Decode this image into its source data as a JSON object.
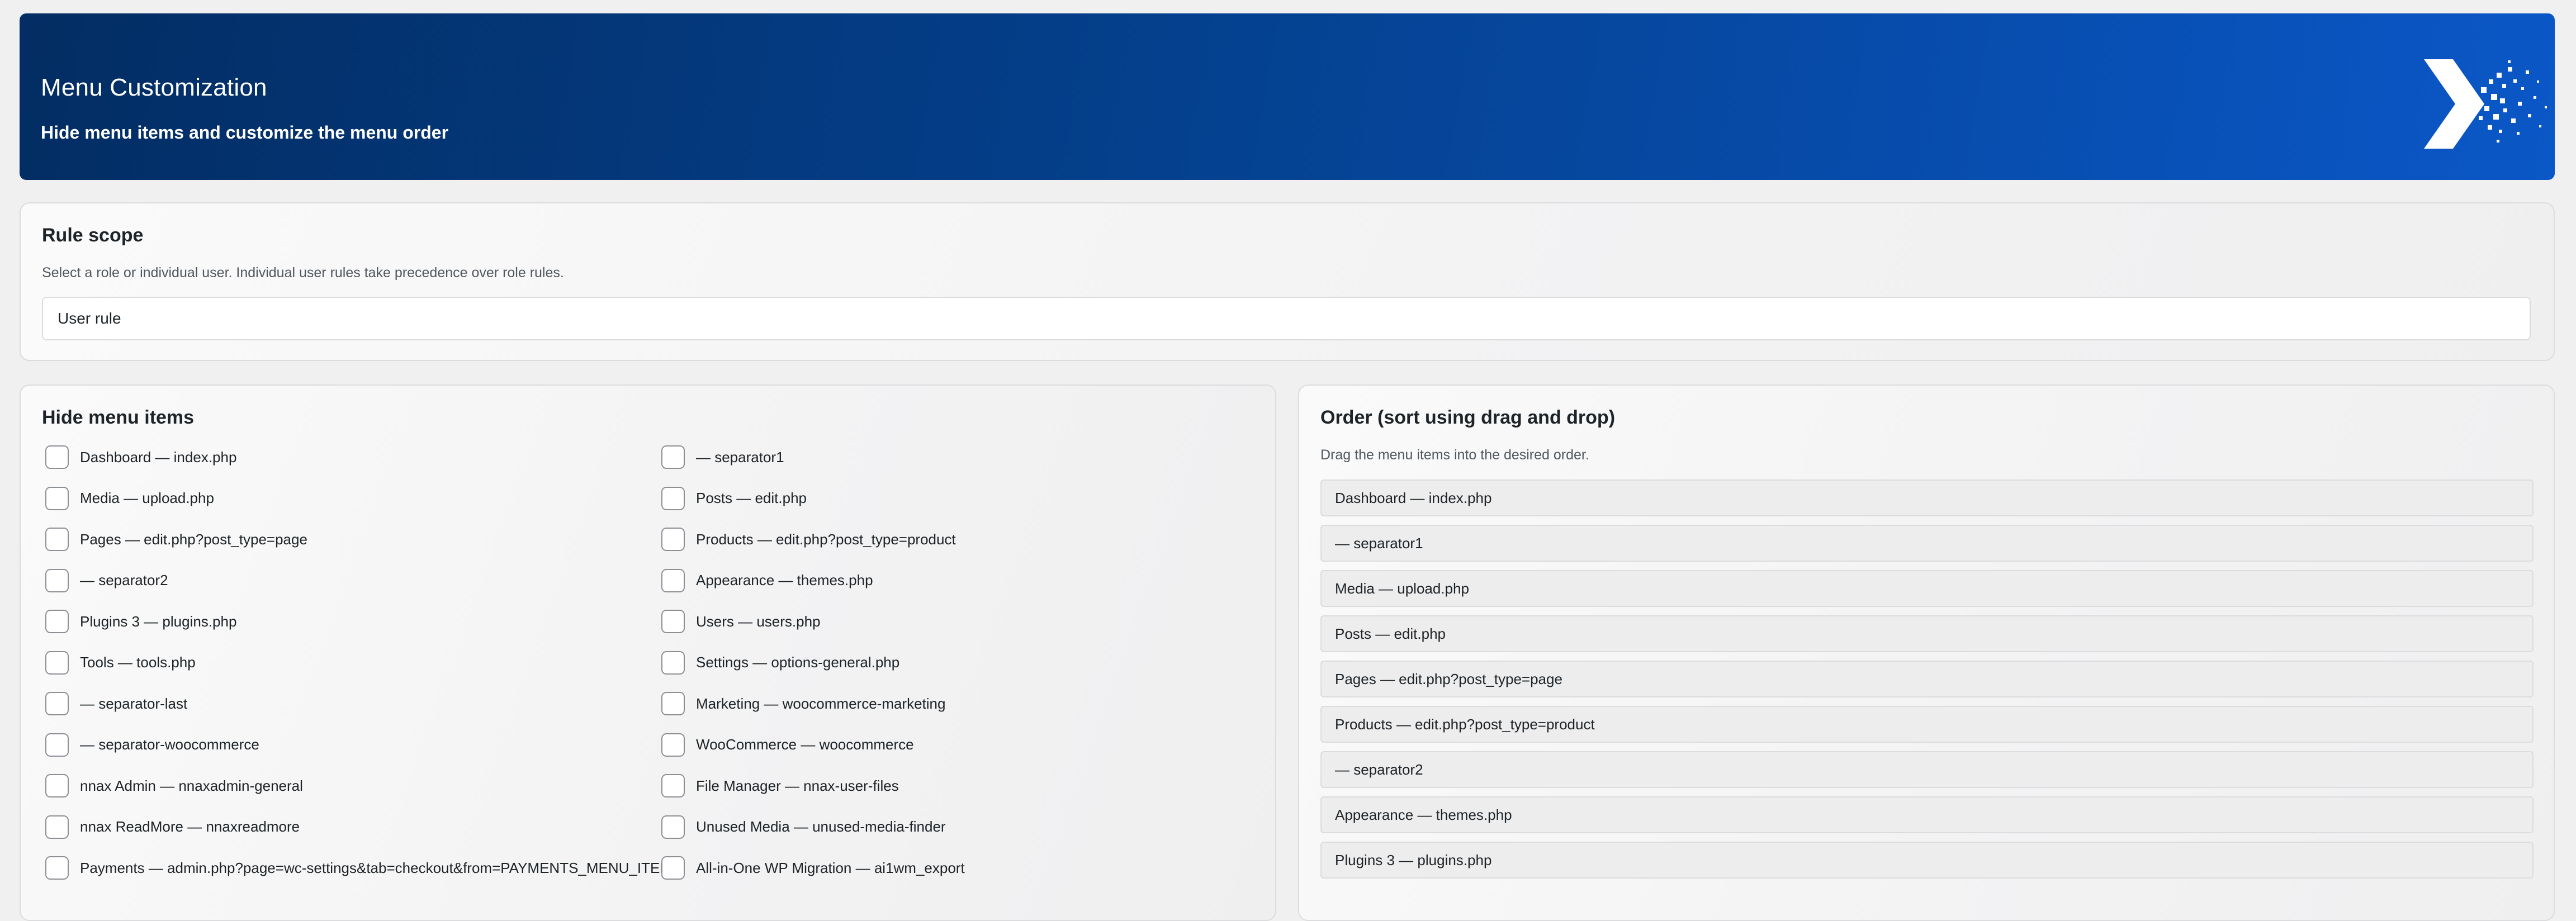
{
  "header": {
    "title": "Menu Customization",
    "subtitle": "Hide menu items and customize the menu order",
    "logo_icon": "brand-logo-icon"
  },
  "rule_scope": {
    "title": "Rule scope",
    "description": "Select a role or individual user. Individual user rules take precedence over role rules.",
    "selected": "User rule"
  },
  "hide_menu": {
    "title": "Hide menu items",
    "items": [
      {
        "label": "Dashboard — index.php",
        "checked": false
      },
      {
        "label": "— separator1",
        "checked": false
      },
      {
        "label": "Media — upload.php",
        "checked": false
      },
      {
        "label": "Posts — edit.php",
        "checked": false
      },
      {
        "label": "Pages — edit.php?post_type=page",
        "checked": false
      },
      {
        "label": "Products — edit.php?post_type=product",
        "checked": false
      },
      {
        "label": "— separator2",
        "checked": false
      },
      {
        "label": "Appearance — themes.php",
        "checked": false
      },
      {
        "label": "Plugins 3 — plugins.php",
        "checked": false
      },
      {
        "label": "Users — users.php",
        "checked": false
      },
      {
        "label": "Tools — tools.php",
        "checked": false
      },
      {
        "label": "Settings — options-general.php",
        "checked": false
      },
      {
        "label": "— separator-last",
        "checked": false
      },
      {
        "label": "Marketing — woocommerce-marketing",
        "checked": false
      },
      {
        "label": "— separator-woocommerce",
        "checked": false
      },
      {
        "label": "WooCommerce — woocommerce",
        "checked": false
      },
      {
        "label": "nnax Admin — nnaxadmin-general",
        "checked": false
      },
      {
        "label": "File Manager — nnax-user-files",
        "checked": false
      },
      {
        "label": "nnax ReadMore — nnaxreadmore",
        "checked": false
      },
      {
        "label": "Unused Media — unused-media-finder",
        "checked": false
      },
      {
        "label": "Payments — admin.php?page=wc-settings&tab=checkout&from=PAYMENTS_MENU_ITEM",
        "checked": false
      },
      {
        "label": "All-in-One WP Migration — ai1wm_export",
        "checked": false
      }
    ]
  },
  "order": {
    "title": "Order (sort using drag and drop)",
    "description": "Drag the menu items into the desired order.",
    "items": [
      "Dashboard — index.php",
      "— separator1",
      "Media — upload.php",
      "Posts — edit.php",
      "Pages — edit.php?post_type=page",
      "Products — edit.php?post_type=product",
      "— separator2",
      "Appearance — themes.php",
      "Plugins 3 — plugins.php"
    ]
  }
}
